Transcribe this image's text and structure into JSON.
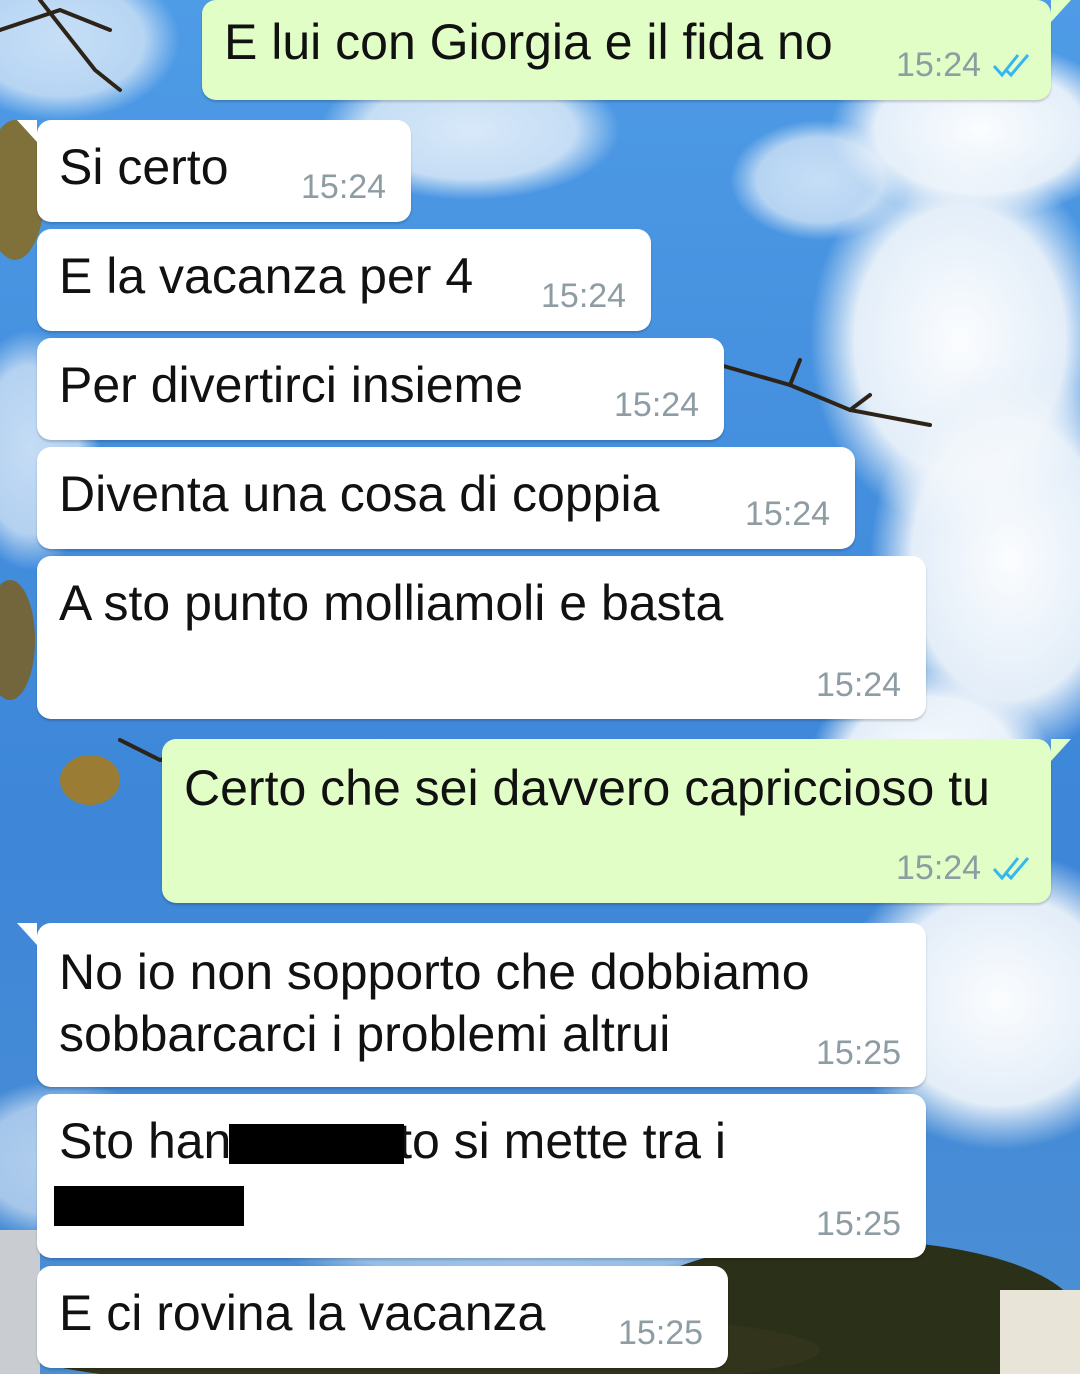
{
  "theme": {
    "incoming_bubble": "#ffffff",
    "outgoing_bubble": "#e1fec6",
    "timestamp_color": "#8e9ca3",
    "read_ticks_color": "#34b7f1",
    "wallpaper": "sky-clouds-tree-photo"
  },
  "messages": [
    {
      "direction": "out",
      "text": "E lui con Giorgia e il fida no",
      "time": "15:24",
      "status": "read-double-check-icon"
    },
    {
      "direction": "in",
      "text": "Si certo",
      "time": "15:24"
    },
    {
      "direction": "in",
      "text": "E la vacanza per 4",
      "time": "15:24"
    },
    {
      "direction": "in",
      "text": "Per divertirci insieme",
      "time": "15:24"
    },
    {
      "direction": "in",
      "text": "Diventa una cosa di coppia",
      "time": "15:24"
    },
    {
      "direction": "in",
      "text": "A sto punto molliamoli e basta",
      "time": "15:24"
    },
    {
      "direction": "out",
      "text": "Certo che sei davvero capriccioso tu",
      "time": "15:24",
      "status": "read-double-check-icon"
    },
    {
      "direction": "in",
      "text": "No io non sopporto che dobbiamo\nsobbarcarci i problemi altrui",
      "time": "15:25"
    },
    {
      "direction": "in",
      "text": "Sto han          ato si mette tra i",
      "time": "15:25",
      "redacted": true
    },
    {
      "direction": "in",
      "text": "E ci rovina la vacanza",
      "time": "15:25"
    }
  ]
}
